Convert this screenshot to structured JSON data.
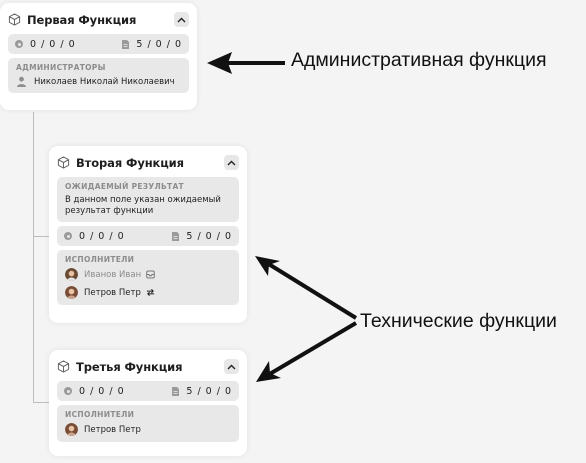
{
  "cards": [
    {
      "title": "Первая Функция",
      "stats_left": "0 / 0 / 0",
      "stats_right": "5 / 0 / 0",
      "section_label": "АДМИНИСТРАТОРЫ",
      "people": [
        {
          "name": "Николаев Николай Николаевич"
        }
      ]
    },
    {
      "title": "Вторая Функция",
      "expected_label": "ОЖИДАЕМЫЙ РЕЗУЛЬТАТ",
      "expected_text": "В данном поле указан ожидаемый результат функции",
      "stats_left": "0 / 0 / 0",
      "stats_right": "5 / 0 / 0",
      "section_label": "ИСПОЛНИТЕЛИ",
      "people": [
        {
          "name": "Иванов Иван"
        },
        {
          "name": "Петров Петр"
        }
      ]
    },
    {
      "title": "Третья Функция",
      "stats_left": "0 / 0 / 0",
      "stats_right": "5 / 0 / 0",
      "section_label": "ИСПОЛНИТЕЛИ",
      "people": [
        {
          "name": "Петров Петр"
        }
      ]
    }
  ],
  "annotations": {
    "admin": "Административная функция",
    "tech": "Технические функции"
  },
  "colors": {
    "card_bg": "#ffffff",
    "block_bg": "#e8e8e8",
    "label_gray": "#8c8c8c",
    "page_bg": "#f4f4f4"
  },
  "icons": [
    "cube-icon",
    "chevron-up-icon",
    "status-dot-icon",
    "document-icon",
    "user-icon",
    "inbox-icon",
    "swap-icon"
  ]
}
